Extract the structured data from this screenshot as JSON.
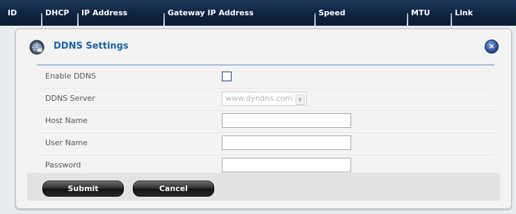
{
  "table_header": {
    "columns": [
      {
        "label": "ID"
      },
      {
        "label": "DHCP"
      },
      {
        "label": "IP Address"
      },
      {
        "label": "Gateway IP Address"
      },
      {
        "label": "Speed"
      },
      {
        "label": "MTU"
      },
      {
        "label": "Link"
      }
    ]
  },
  "dialog": {
    "title": "DDNS Settings",
    "close_label": "×",
    "fields": {
      "enable_ddns": {
        "label": "Enable DDNS",
        "checked": false
      },
      "ddns_server": {
        "label": "DDNS Server",
        "value": "www.dyndns.com"
      },
      "host_name": {
        "label": "Host Name",
        "value": ""
      },
      "user_name": {
        "label": "User Name",
        "value": ""
      },
      "password": {
        "label": "Password",
        "value": ""
      }
    },
    "buttons": {
      "submit": "Submit",
      "cancel": "Cancel"
    }
  },
  "colors": {
    "header_bg": "#0f2340",
    "title_blue": "#1b63a5",
    "rule_blue": "#5a8ec6"
  }
}
